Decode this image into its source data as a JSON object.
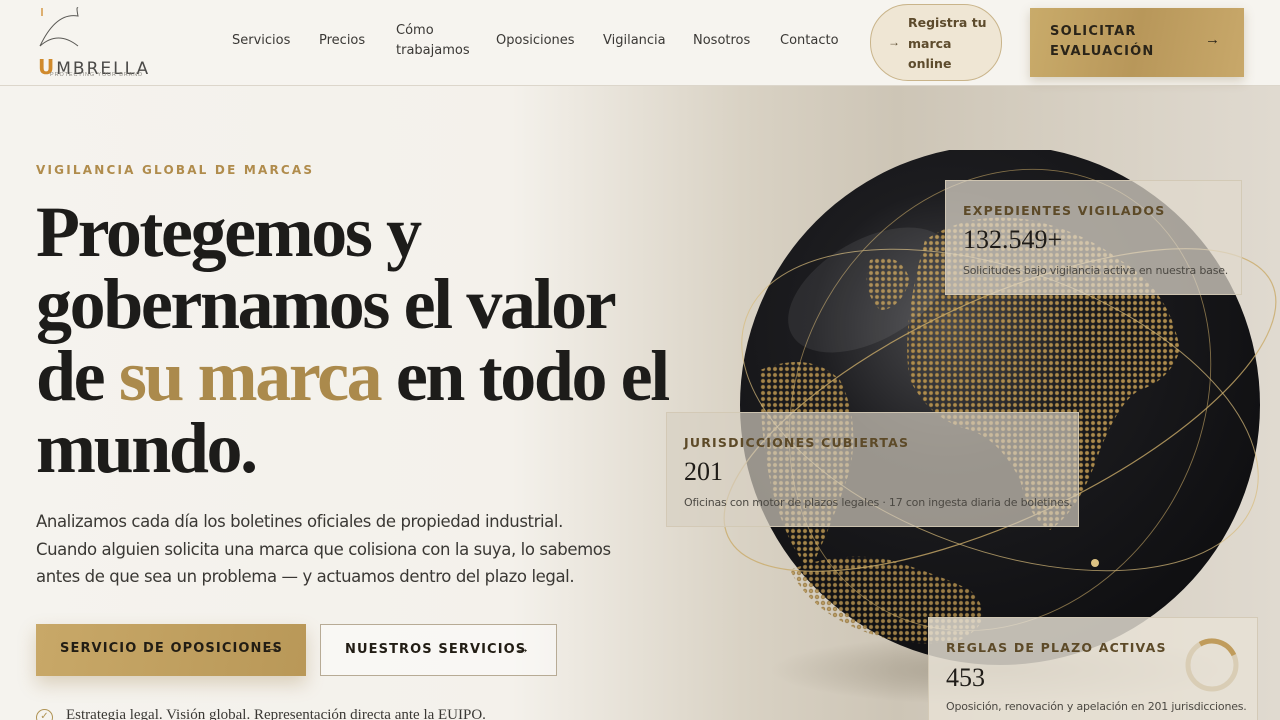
{
  "header": {
    "logo_text": "MBRELLA",
    "logo_initial": "U",
    "logo_tagline": "PROTECTING YOUR BRAND",
    "nav": [
      "Servicios",
      "Precios",
      "Cómo",
      "trabajamos",
      "Oposiciones",
      "Vigilancia",
      "Nosotros",
      "Contacto"
    ],
    "pill_cta": [
      "Registra tu",
      "marca",
      "online"
    ],
    "main_cta": [
      "SOLICITAR",
      "EVALUACIÓN"
    ]
  },
  "hero": {
    "eyebrow": "VIGILANCIA GLOBAL DE MARCAS",
    "headline_1": "Protegemos y",
    "headline_2": "gobernamos el valor",
    "headline_3a": "de ",
    "headline_3b": "su marca",
    "headline_3c": " en todo el",
    "headline_4": "mundo.",
    "description": "Analizamos cada día los boletines oficiales de propiedad industrial. Cuando alguien solicita una marca que colisiona con la suya, lo sabemos antes de que sea un problema — y actuamos dentro del plazo legal.",
    "primary_button": "SERVICIO DE OPOSICIONES",
    "secondary_button": "NUESTROS SERVICIOS",
    "check_text": "Estrategia legal. Visión global. Representación directa ante la EUIPO."
  },
  "stats": [
    {
      "label": "EXPEDIENTES VIGILADOS",
      "value": "132.549+",
      "note": "Solicitudes bajo vigilancia activa en nuestra base."
    },
    {
      "label": "JURISDICCIONES CUBIERTAS",
      "value": "201",
      "note": "Oficinas con motor de plazos legales · 17 con ingesta diaria de boletines."
    },
    {
      "label": "REGLAS DE PLAZO ACTIVAS",
      "value": "453",
      "note": "Oposición, renovación y apelación en 201 jurisdicciones."
    }
  ],
  "icons": {
    "arrow": "arrow-right-icon",
    "check": "check-circle-icon",
    "umbrella": "umbrella-icon",
    "globe": "globe-illustration"
  },
  "colors": {
    "gold": "#b08c4c",
    "dark": "#1d1c1a",
    "background": "#f5f3ee"
  }
}
